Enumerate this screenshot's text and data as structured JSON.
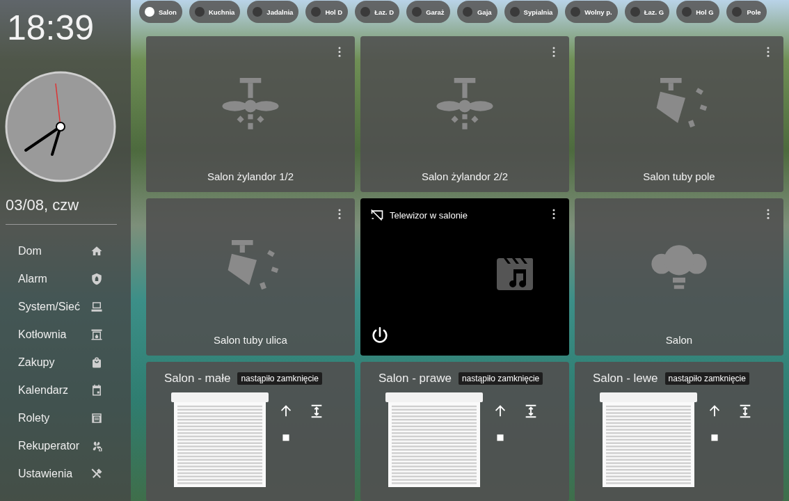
{
  "clock": {
    "time": "18:39",
    "date": "03/08, czw"
  },
  "menu": [
    {
      "label": "Dom",
      "kind": "home"
    },
    {
      "label": "Alarm",
      "kind": "shield"
    },
    {
      "label": "System/Sieć",
      "kind": "computer"
    },
    {
      "label": "Kotłownia",
      "kind": "fireplace"
    },
    {
      "label": "Zakupy",
      "kind": "bag"
    },
    {
      "label": "Kalendarz",
      "kind": "calendar"
    },
    {
      "label": "Rolety",
      "kind": "shutter"
    },
    {
      "label": "Rekuperator",
      "kind": "fan"
    },
    {
      "label": "Ustawienia",
      "kind": "tools"
    }
  ],
  "rooms": [
    {
      "label": "Salon",
      "selected": true
    },
    {
      "label": "Kuchnia",
      "selected": false
    },
    {
      "label": "Jadalnia",
      "selected": false
    },
    {
      "label": "Hol D",
      "selected": false
    },
    {
      "label": "Łaz. D",
      "selected": false
    },
    {
      "label": "Garaż",
      "selected": false
    },
    {
      "label": "Gaja",
      "selected": false
    },
    {
      "label": "Sypialnia",
      "selected": false
    },
    {
      "label": "Wolny p.",
      "selected": false
    },
    {
      "label": "Łaz. G",
      "selected": false
    },
    {
      "label": "Hol G",
      "selected": false
    },
    {
      "label": "Pole",
      "selected": false
    }
  ],
  "tiles": [
    {
      "kind": "ceiling-fan",
      "name": "Salon żylandor 1/2"
    },
    {
      "kind": "ceiling-fan",
      "name": "Salon żylandor 2/2"
    },
    {
      "kind": "spotlight",
      "name": "Salon tuby pole"
    },
    {
      "kind": "spotlight",
      "name": "Salon tuby ulica"
    },
    {
      "kind": "media",
      "name": "Telewizor w salonie"
    },
    {
      "kind": "bulbs",
      "name": "Salon"
    }
  ],
  "blinds": [
    {
      "name": "Salon - małe",
      "status": "nastąpiło zamknięcie"
    },
    {
      "name": "Salon - prawe",
      "status": "nastąpiło zamknięcie"
    },
    {
      "name": "Salon - lewe",
      "status": "nastąpiło zamknięcie"
    }
  ]
}
